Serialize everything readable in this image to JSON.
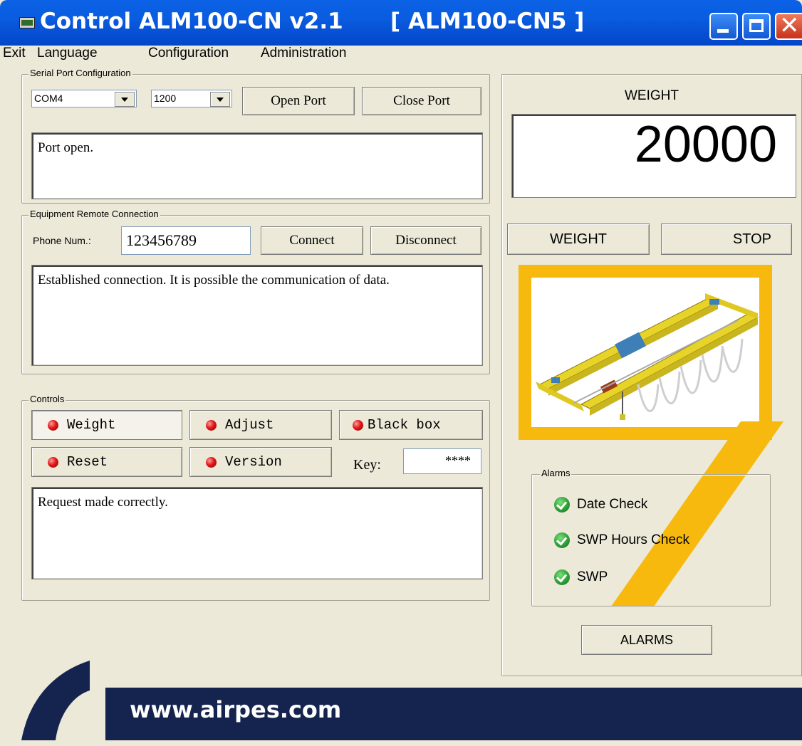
{
  "window": {
    "title": "Control ALM100-CN v2.1",
    "device": "[ ALM100-CN5  ]",
    "title_color": "#0a5ce0"
  },
  "menu": [
    "Exit",
    "Language",
    "Configuration",
    "Administration"
  ],
  "serial_port": {
    "legend": "Serial Port Configuration",
    "port": "COM4",
    "baud": "1200",
    "open_label": "Open Port",
    "close_label": "Close Port",
    "log": "Port open."
  },
  "remote": {
    "legend": "Equipment Remote Connection",
    "phone_label": "Phone Num.:",
    "phone_value": "123456789",
    "connect_label": "Connect",
    "disconnect_label": "Disconnect",
    "log": "Established connection. It is possible the communication of data."
  },
  "controls": {
    "legend": "Controls",
    "weight_label": "Weight",
    "adjust_label": "Adjust",
    "blackbox_label": "Black box",
    "reset_label": "Reset",
    "version_label": "Version",
    "key_label": "Key:",
    "key_value": "****",
    "log": "Request made correctly."
  },
  "weight_panel": {
    "heading": "WEIGHT",
    "value": "20000",
    "weight_button": "WEIGHT",
    "stop_button": "STOP"
  },
  "alarms": {
    "legend": "Alarms",
    "items": [
      "Date Check",
      "SWP Hours Check",
      "SWP"
    ],
    "button": "ALARMS"
  },
  "footer": {
    "url": "www.airpes.com",
    "bar_color": "#14244e"
  },
  "accent_color": "#f7b90e"
}
